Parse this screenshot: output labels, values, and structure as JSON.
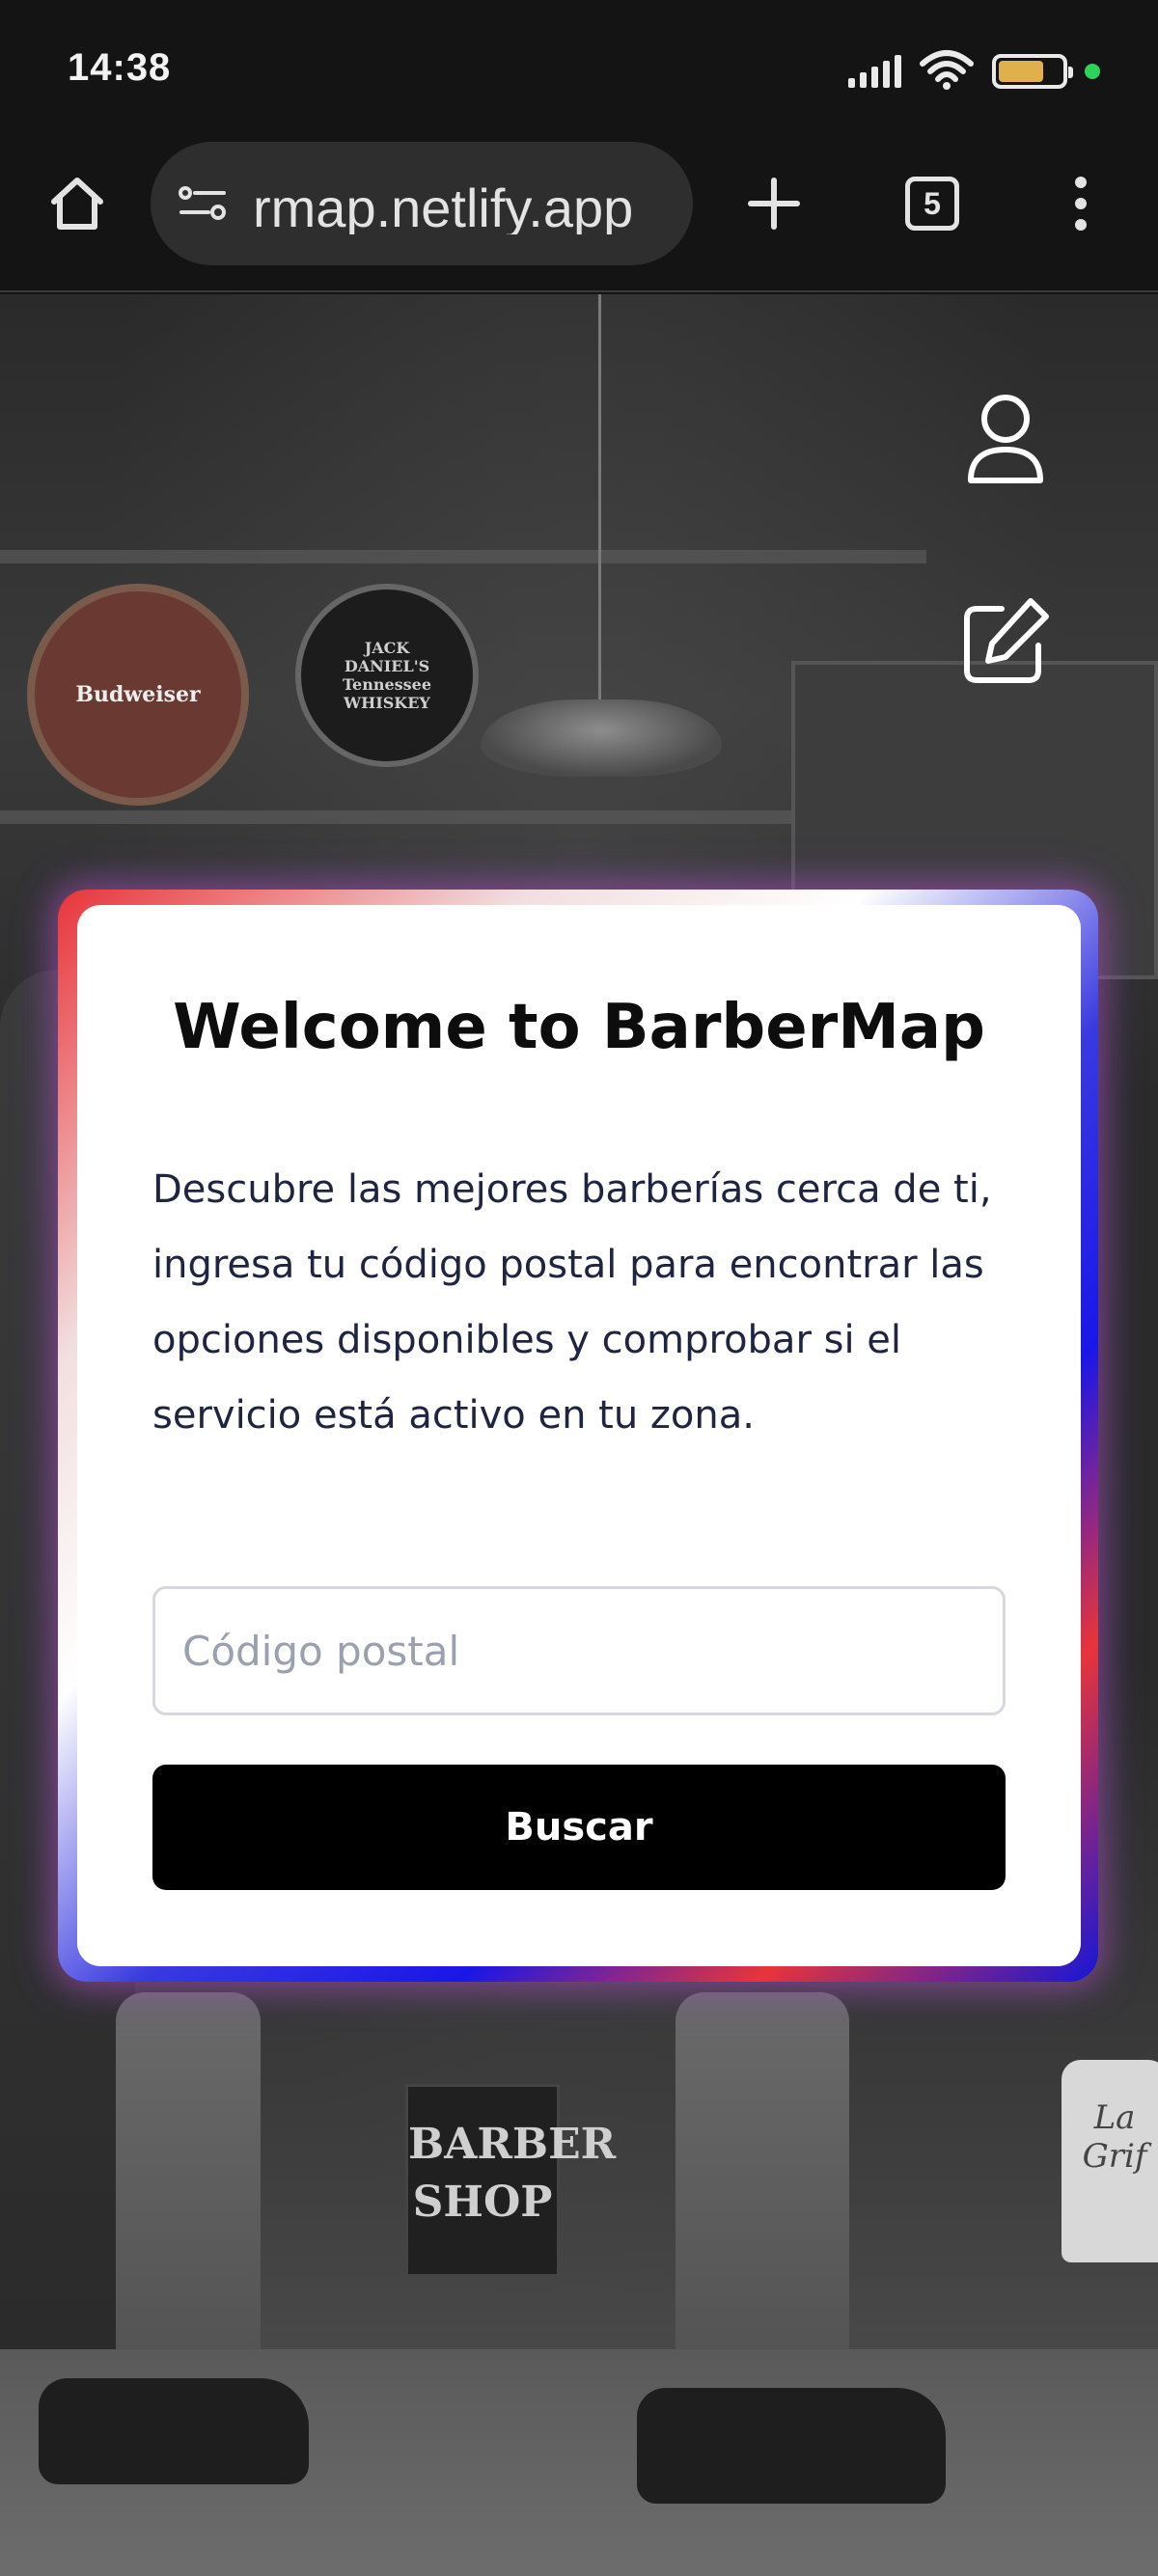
{
  "status_bar": {
    "time": "14:38",
    "battery_level": 0.72,
    "colors": {
      "battery": "#e0b04a",
      "dot": "#2fd25a"
    }
  },
  "browser": {
    "url": "barbermap.netlify.app",
    "visible_url": "rmap.netlify.app",
    "tab_count": "5",
    "icons": [
      "home-icon",
      "site-settings-icon",
      "new-tab-icon",
      "tabs-icon",
      "more-menu-icon"
    ]
  },
  "page": {
    "side_icons": [
      "user-profile-icon",
      "edit-icon"
    ],
    "background": {
      "sign_budweiser": "Budweiser",
      "sign_jack": "JACK DANIEL'S Tennessee WHISKEY",
      "barber_sign": "BARBER SHOP",
      "bottle_label": "La Grif"
    }
  },
  "welcome_card": {
    "title": "Welcome to BarberMap",
    "description": "Descubre las mejores barberías cerca de ti, ingresa tu código postal para encontrar las opciones disponibles y comprobar si el servicio está activo en tu zona.",
    "postal_input": {
      "placeholder": "Código postal",
      "value": ""
    },
    "search_button_label": "Buscar",
    "border_colors": [
      "#e8343a",
      "#ffffff",
      "#1a16e8"
    ]
  }
}
